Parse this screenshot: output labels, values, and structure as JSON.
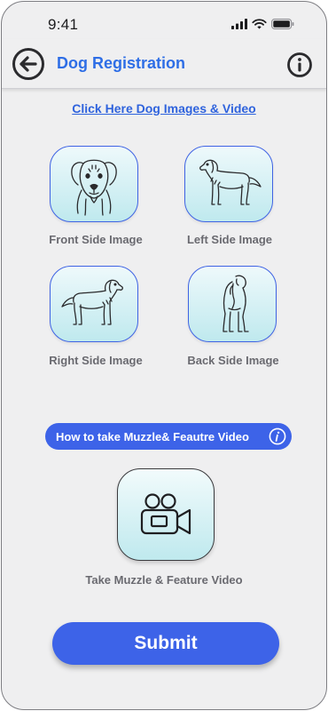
{
  "status_bar": {
    "time": "9:41"
  },
  "header": {
    "title": "Dog Registration"
  },
  "main": {
    "link_text": "Click Here Dog Images & Video",
    "tiles": [
      {
        "label": "Front Side Image",
        "icon": "dog-front-icon"
      },
      {
        "label": "Left Side Image",
        "icon": "dog-left-side-icon"
      },
      {
        "label": "Right Side Image",
        "icon": "dog-right-side-icon"
      },
      {
        "label": "Back Side Image",
        "icon": "dog-back-icon"
      }
    ],
    "video_guide_label": "How to take Muzzle& Feautre Video",
    "video_label": "Take Muzzle & Feature Video",
    "submit_label": "Submit"
  },
  "colors": {
    "accent": "#3d63e8",
    "title_blue": "#2e6ee6",
    "tile_gradient_top": "#eef9fb",
    "tile_gradient_bottom": "#bfe9ee",
    "label_gray": "#6a6a70",
    "background": "#efeff0"
  }
}
